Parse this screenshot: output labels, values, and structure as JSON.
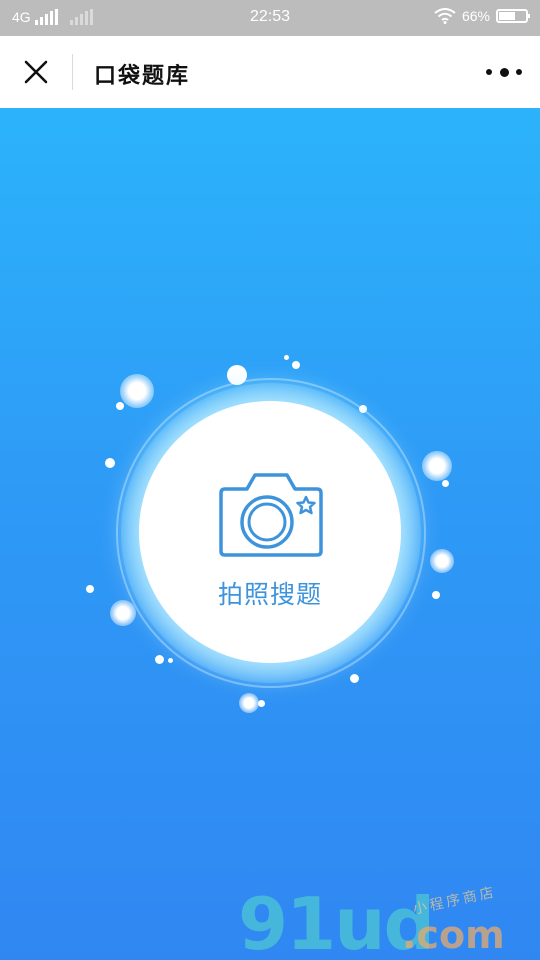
{
  "status_bar": {
    "network": "4G",
    "time": "22:53",
    "battery_percent": "66%",
    "battery_level": 0.66
  },
  "nav": {
    "title": "口袋题库",
    "close_icon": "close-icon",
    "more_icon": "more-icon"
  },
  "main": {
    "camera_label": "拍照搜题",
    "camera_icon": "camera-icon",
    "accent_color": "#3d94dc",
    "background_top": "#2cb3fb",
    "background_bottom": "#3087f2"
  },
  "watermark": {
    "main": "91ud",
    "domain": ".com",
    "tag": "小程序商店"
  }
}
